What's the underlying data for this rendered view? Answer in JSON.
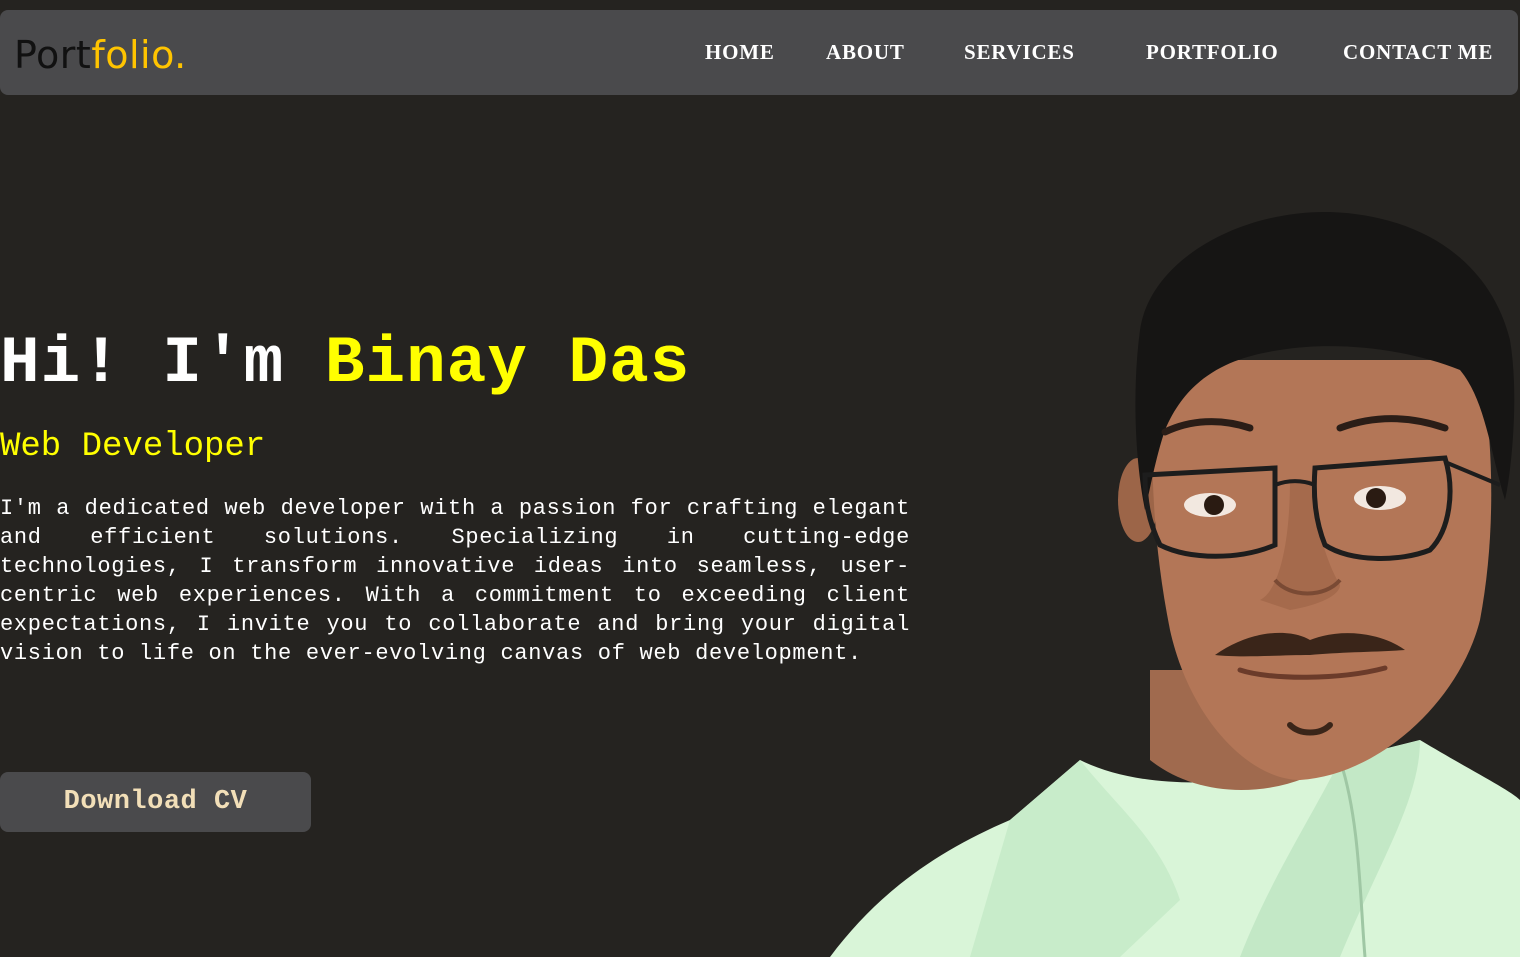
{
  "navbar": {
    "logo": {
      "part1": "Port",
      "part2": "folio",
      "dot": "."
    },
    "links": [
      {
        "label": "HOME"
      },
      {
        "label": "ABOUT"
      },
      {
        "label": "SERVICES"
      },
      {
        "label": "PORTFOLIO"
      },
      {
        "label": "CONTACT ME"
      }
    ]
  },
  "hero": {
    "greeting": "Hi! I'm",
    "name": "Binay Das",
    "subtitle": "Web Developer",
    "description": "I'm a dedicated web developer with a passion for crafting elegant and efficient solutions. Specializing in cutting-edge technologies, I transform innovative ideas into seamless, user-centric web experiences. With a commitment to exceeding client expectations, I invite you to collaborate and bring your digital vision to life on the ever-evolving canvas of web development.",
    "cv_button": "Download CV"
  },
  "colors": {
    "background": "#252320",
    "navbar": "#4a4a4c",
    "accent_yellow": "#ffff00",
    "logo_accent": "#ffc400",
    "button_text": "#f2dfb8"
  },
  "portrait": {
    "icon": "person-portrait-photo"
  }
}
